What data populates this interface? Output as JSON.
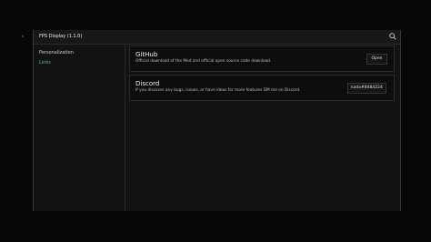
{
  "window": {
    "title": "FPS Display (1.1.0)"
  },
  "sidebar": {
    "items": [
      {
        "label": "Personalization",
        "active": false
      },
      {
        "label": "Links",
        "active": true
      }
    ]
  },
  "cards": [
    {
      "title": "GitHub",
      "description": "Official download of the Mod and official open source code download.",
      "button_label": "Open"
    },
    {
      "title": "Discord",
      "description": "If you discover any bugs, issues, or have ideas for more features DM me on Discord.",
      "button_label": "kada#8484224"
    }
  ],
  "icons": {
    "back": "chevron-left-icon",
    "search": "search-icon"
  },
  "colors": {
    "background": "#070707",
    "panel": "#121212",
    "accent": "#34d36a"
  }
}
